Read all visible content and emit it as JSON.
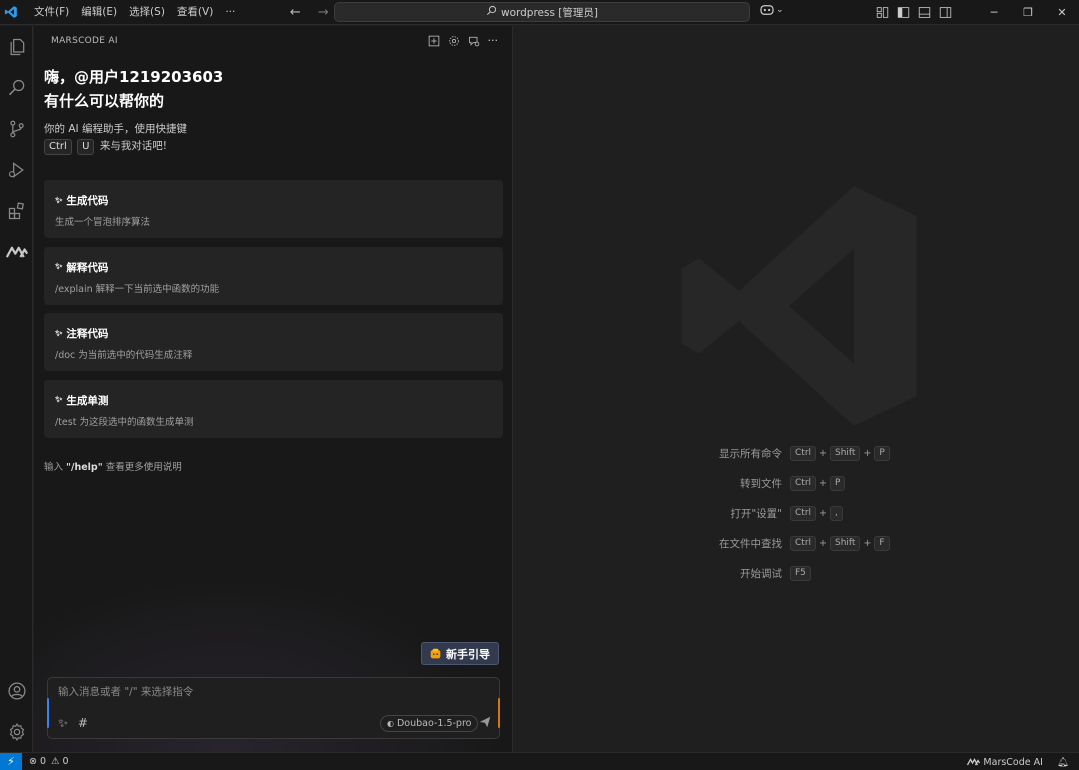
{
  "titlebar": {
    "menu": [
      "文件(F)",
      "编辑(E)",
      "选择(S)",
      "查看(V)",
      "···"
    ],
    "search_text": "wordpress [管理员]"
  },
  "sidebar": {
    "header": "MARSCODE AI",
    "greeting_line1": "嗨，@用户1219203603",
    "greeting_line2": "有什么可以帮你的",
    "intro_line1": "你的 AI 编程助手，使用快捷键",
    "key1": "Ctrl",
    "key2": "U",
    "intro_line2_tail": "来与我对话吧!",
    "cards": [
      {
        "title": "生成代码",
        "desc": "生成一个冒泡排序算法"
      },
      {
        "title": "解释代码",
        "desc": "/explain 解释一下当前选中函数的功能"
      },
      {
        "title": "注释代码",
        "desc": "/doc 为当前选中的代码生成注释"
      },
      {
        "title": "生成单测",
        "desc": "/test 为这段选中的函数生成单测"
      }
    ],
    "help_prefix": "输入",
    "help_cmd": "\"/help\"",
    "help_suffix": "查看更多使用说明",
    "guide_button": "新手引导",
    "chat_placeholder": "输入消息或者 \"/\" 来选择指令",
    "model": "Doubao-1.5-pro",
    "chat_tool_hash": "#"
  },
  "editor": {
    "shortcuts": [
      {
        "label": "显示所有命令",
        "keys": [
          "Ctrl",
          "Shift",
          "P"
        ]
      },
      {
        "label": "转到文件",
        "keys": [
          "Ctrl",
          "P"
        ]
      },
      {
        "label": "打开\"设置\"",
        "keys": [
          "Ctrl",
          ","
        ]
      },
      {
        "label": "在文件中查找",
        "keys": [
          "Ctrl",
          "Shift",
          "F"
        ]
      },
      {
        "label": "开始调试",
        "keys": [
          "F5"
        ]
      }
    ],
    "plus": "+"
  },
  "statusbar": {
    "errors": "0",
    "warnings": "0",
    "marscode": "MarsCode AI"
  },
  "colors": {
    "accent": "#0078d4",
    "background": "#1f1f1f",
    "panel": "#181818",
    "card": "#242424"
  }
}
